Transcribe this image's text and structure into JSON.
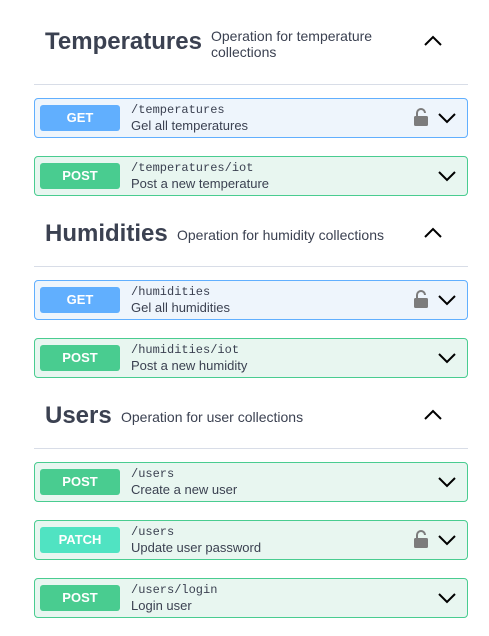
{
  "sections": [
    {
      "title": "Temperatures",
      "description_line1": "Operation for temperature",
      "description_line2": "collections",
      "operations": [
        {
          "method": "GET",
          "path": "/temperatures",
          "summary": "Gel all temperatures",
          "locked": true
        },
        {
          "method": "POST",
          "path": "/temperatures/iot",
          "summary": "Post a new temperature",
          "locked": false
        }
      ]
    },
    {
      "title": "Humidities",
      "description_line1": "Operation for humidity collections",
      "operations": [
        {
          "method": "GET",
          "path": "/humidities",
          "summary": "Gel all humidities",
          "locked": true
        },
        {
          "method": "POST",
          "path": "/humidities/iot",
          "summary": "Post a new humidity",
          "locked": false
        }
      ]
    },
    {
      "title": "Users",
      "description_line1": "Operation for user collections",
      "operations": [
        {
          "method": "POST",
          "path": "/users",
          "summary": "Create a new user",
          "locked": false
        },
        {
          "method": "PATCH",
          "path": "/users",
          "summary": "Update user password",
          "locked": true
        },
        {
          "method": "POST",
          "path": "/users/login",
          "summary": "Login user",
          "locked": false
        }
      ]
    }
  ],
  "colors": {
    "get": "#61affe",
    "post": "#49cc90",
    "patch": "#50e3c2",
    "text": "#3b4151"
  },
  "icons": {
    "collapse": "chevron-up-icon",
    "expand": "chevron-down-icon",
    "lock": "lock-icon"
  }
}
